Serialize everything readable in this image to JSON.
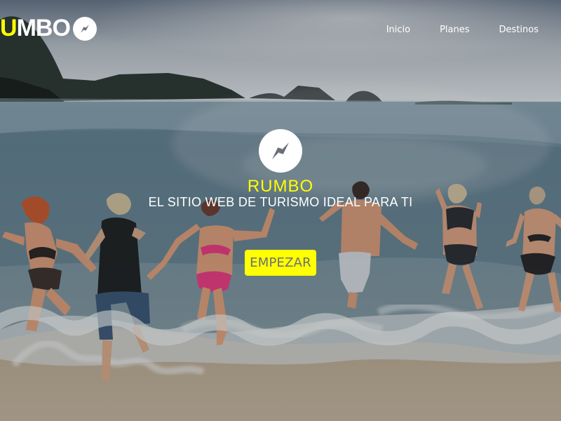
{
  "header": {
    "logo_text": "UMBO",
    "logo_accent": "U",
    "logo_rest": "MBO",
    "nav": [
      {
        "label": "Inicio"
      },
      {
        "label": "Planes"
      },
      {
        "label": "Destinos"
      }
    ]
  },
  "hero": {
    "brand": "RUMBO",
    "tagline": "EL SITIO WEB DE TURISMO IDEAL PARA TI",
    "cta_label": "EMPEZAR"
  },
  "icons": {
    "logo": "compass-icon",
    "hero": "compass-icon"
  },
  "colors": {
    "accent": "#ffff00",
    "white": "#ffffff",
    "cta_text": "#6a6f7a"
  }
}
